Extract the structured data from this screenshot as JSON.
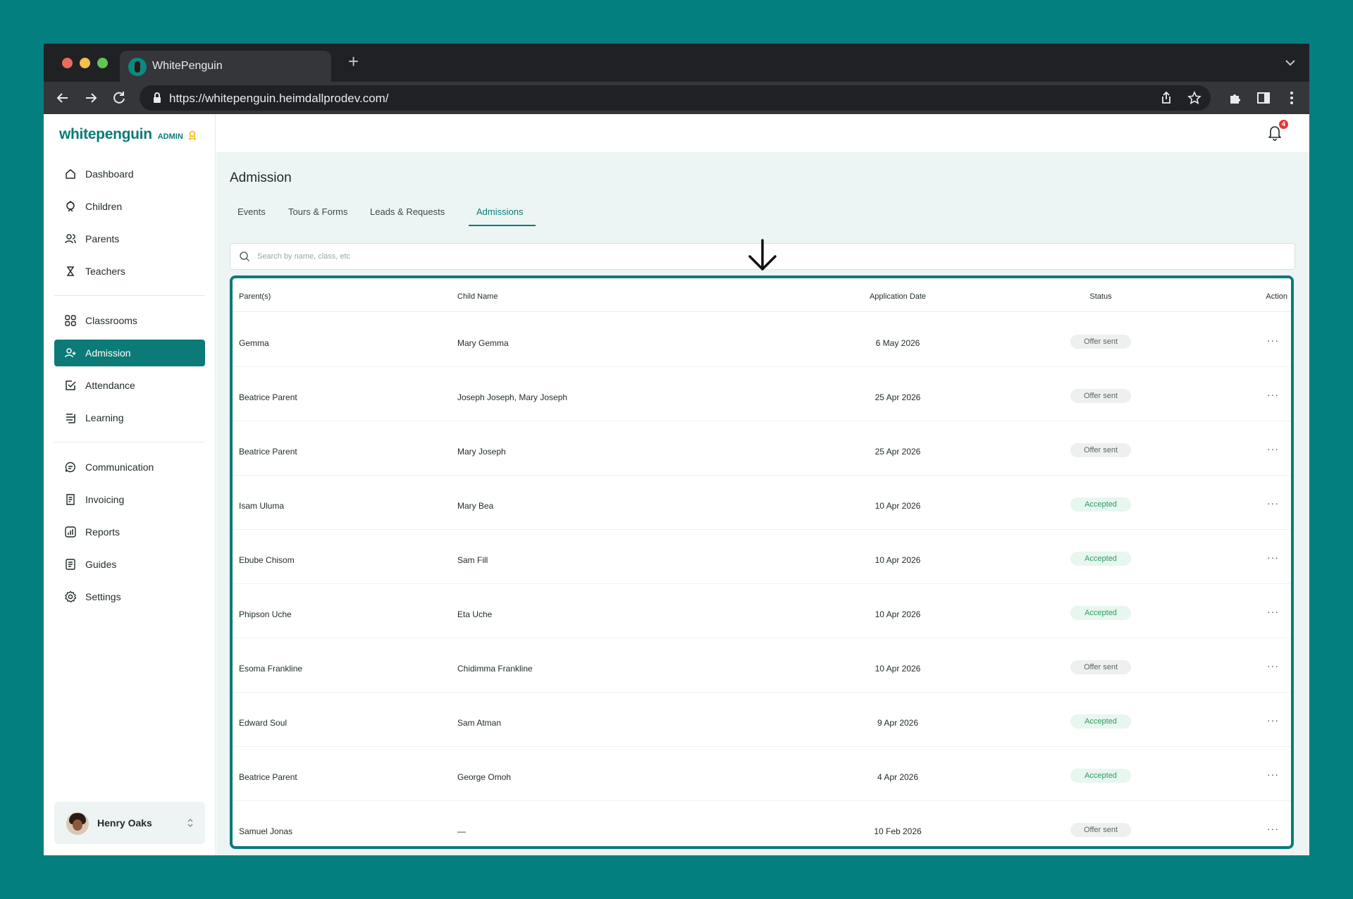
{
  "browser": {
    "tab_title": "WhitePenguin",
    "url": "https://whitepenguin.heimdallprodev.com/"
  },
  "brand": {
    "logo_text": "whitepenguin",
    "role_label": "ADMIN",
    "accent_color": "#0c7a76"
  },
  "sidebar": {
    "items": [
      {
        "label": "Dashboard",
        "icon": "home-icon"
      },
      {
        "label": "Children",
        "icon": "child-icon"
      },
      {
        "label": "Parents",
        "icon": "parents-icon"
      },
      {
        "label": "Teachers",
        "icon": "teacher-icon"
      },
      {
        "label": "Classrooms",
        "icon": "grid-icon"
      },
      {
        "label": "Admission",
        "icon": "user-plus-icon",
        "active": true
      },
      {
        "label": "Attendance",
        "icon": "check-square-icon"
      },
      {
        "label": "Learning",
        "icon": "book-icon"
      },
      {
        "label": "Communication",
        "icon": "chat-icon"
      },
      {
        "label": "Invoicing",
        "icon": "invoice-icon"
      },
      {
        "label": "Reports",
        "icon": "chart-icon"
      },
      {
        "label": "Guides",
        "icon": "guide-icon"
      },
      {
        "label": "Settings",
        "icon": "gear-icon"
      }
    ],
    "user": {
      "name": "Henry Oaks"
    }
  },
  "header": {
    "notification_count": "4"
  },
  "page": {
    "title": "Admission",
    "tabs": [
      "Events",
      "Tours & Forms",
      "Leads & Requests",
      "Admissions"
    ],
    "active_tab": "Admissions",
    "search_placeholder": "Search by name, class, etc"
  },
  "table": {
    "columns": [
      "Parent(s)",
      "Child Name",
      "Application Date",
      "Status",
      "Action"
    ],
    "rows": [
      {
        "parent": "Gemma",
        "child": "Mary Gemma",
        "date": "6 May 2026",
        "status": "Offer sent",
        "action": "···"
      },
      {
        "parent": "Beatrice Parent",
        "child": "Joseph Joseph, Mary Joseph",
        "date": "25 Apr 2026",
        "status": "Offer sent",
        "action": "···"
      },
      {
        "parent": "Beatrice Parent",
        "child": "Mary Joseph",
        "date": "25 Apr 2026",
        "status": "Offer sent",
        "action": "···"
      },
      {
        "parent": "Isam Uluma",
        "child": "Mary Bea",
        "date": "10 Apr 2026",
        "status": "Accepted",
        "action": "···"
      },
      {
        "parent": "Ebube Chisom",
        "child": "Sam Fill",
        "date": "10 Apr 2026",
        "status": "Accepted",
        "action": "···"
      },
      {
        "parent": "Phipson Uche",
        "child": "Eta Uche",
        "date": "10 Apr 2026",
        "status": "Accepted",
        "action": "···"
      },
      {
        "parent": "Esoma Frankline",
        "child": "Chidimma Frankline",
        "date": "10 Apr 2026",
        "status": "Offer sent",
        "action": "···"
      },
      {
        "parent": "Edward Soul",
        "child": "Sam Atman",
        "date": "9 Apr 2026",
        "status": "Accepted",
        "action": "···"
      },
      {
        "parent": "Beatrice Parent",
        "child": "George Omoh",
        "date": "4 Apr 2026",
        "status": "Accepted",
        "action": "···"
      },
      {
        "parent": "Samuel Jonas",
        "child": "—",
        "date": "10 Feb 2026",
        "status": "Offer sent",
        "action": "···"
      }
    ]
  }
}
